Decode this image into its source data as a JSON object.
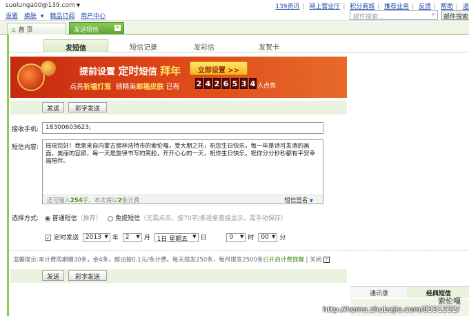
{
  "topbar": {
    "account": "suolunga00@139.com",
    "links": [
      "设置",
      "换肤",
      "精品订阅",
      "用户中心"
    ],
    "right_links": [
      "139资讯",
      "网上营业厅",
      "积分商城",
      "推荐业务",
      "反馈",
      "帮助",
      "退"
    ],
    "search_placeholder": "邮件搜索...",
    "search_button": "邮件搜索"
  },
  "tabs": {
    "home": "首 页",
    "sms": "发送短信"
  },
  "subtabs": [
    "发短信",
    "短信记录",
    "发彩信",
    "发贺卡"
  ],
  "banner": {
    "line1_a": "提前设置",
    "line1_b": "定时",
    "line1_c": "短信",
    "line1_d": "拜年",
    "button": "立即设置 >>",
    "line2_a": "点亮",
    "line2_b": "祈福灯笼",
    "line2_c": "领精美",
    "line2_d": "邮箱皮肤",
    "line2_e": "已有",
    "digits": [
      "2",
      "4",
      "2",
      "6",
      "5",
      "3",
      "4"
    ],
    "line2_f": "人点亮"
  },
  "actions": {
    "send": "发送",
    "mms_send": "彩字发送"
  },
  "form": {
    "recipient_label": "接收手机:",
    "recipient_value": "18300603623;",
    "content_label": "短信内容:",
    "content_text": "瑶瑶您好！我是来自内蒙古锡林浩特市的索伦嘎，受大朋之托，祝您生日快乐，每一年是诗可发酒的画面，美丽的容颜，每一天是旋律书写的笑脸，开开心心的一天，祝你生日快乐，祝你分分秒秒都有平安幸福陪伴。",
    "remain_a": "还可输入",
    "remain_num": "254",
    "remain_b": "字，本次将以",
    "remain_num2": "2",
    "remain_c": "条计费",
    "signature": "短信签名"
  },
  "mode": {
    "label": "选择方式:",
    "normal": "普通短信",
    "normal_note": "（推荐）",
    "flash": "免提短信",
    "flash_note": "（无需点击，按70字/条逐条直接显示，需手动保存）"
  },
  "schedule": {
    "label": "定时发送",
    "year": "2013",
    "year_unit": "年",
    "month": "2",
    "month_unit": "月",
    "day": "1日 星期五",
    "day_unit": "日",
    "hour": "0",
    "hour_unit": "时",
    "minute": "00",
    "minute_unit": "分"
  },
  "tip": {
    "a": "温馨提示:本计费周期赠30条，余4条，超出按0.1元/条计费。每天限发250条，每月限发2500条",
    "b": "已开启计费提醒",
    "c": " | 关闭 "
  },
  "right_panel": {
    "tab1": "通讯录",
    "tab2": "经典短信"
  },
  "watermark": {
    "name": "索伦嘎",
    "url": "http://home.zhubajie.com/8331232/"
  }
}
